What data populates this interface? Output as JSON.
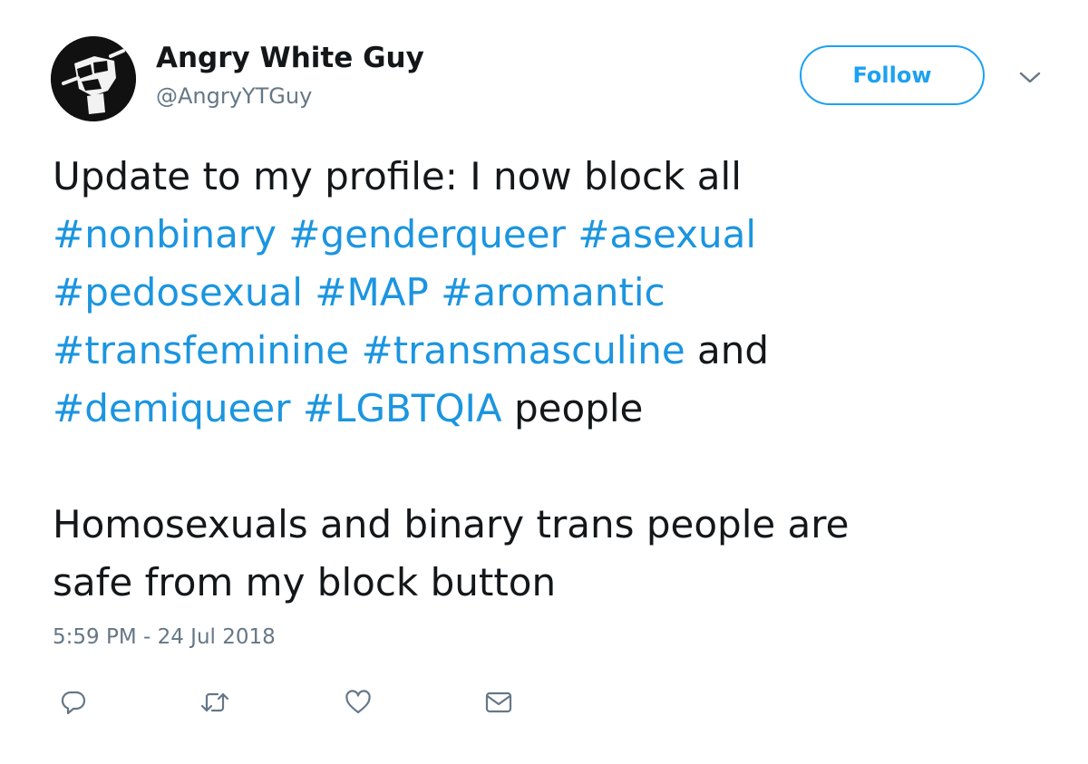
{
  "author": {
    "display_name": "Angry White Guy",
    "handle": "@AngryYTGuy",
    "avatar_icon": "raised-fist-icon"
  },
  "header": {
    "follow_label": "Follow",
    "menu_icon": "chevron-down-icon"
  },
  "tweet": {
    "lines": [
      [
        {
          "text": "Update to my profile: I now block all",
          "type": "text"
        }
      ],
      [
        {
          "text": "#nonbinary",
          "type": "hashtag"
        },
        {
          "text": " ",
          "type": "text"
        },
        {
          "text": "#genderqueer",
          "type": "hashtag"
        },
        {
          "text": " ",
          "type": "text"
        },
        {
          "text": "#asexual",
          "type": "hashtag"
        }
      ],
      [
        {
          "text": "#pedosexual",
          "type": "hashtag"
        },
        {
          "text": " ",
          "type": "text"
        },
        {
          "text": "#MAP",
          "type": "hashtag"
        },
        {
          "text": " ",
          "type": "text"
        },
        {
          "text": "#aromantic",
          "type": "hashtag"
        }
      ],
      [
        {
          "text": "#transfeminine",
          "type": "hashtag"
        },
        {
          "text": " ",
          "type": "text"
        },
        {
          "text": "#transmasculine",
          "type": "hashtag"
        },
        {
          "text": " and",
          "type": "text"
        }
      ],
      [
        {
          "text": "#demiqueer",
          "type": "hashtag"
        },
        {
          "text": " ",
          "type": "text"
        },
        {
          "text": "#LGBTQIA",
          "type": "hashtag"
        },
        {
          "text": " people",
          "type": "text"
        }
      ],
      [],
      [
        {
          "text": "Homosexuals and binary trans people are",
          "type": "text"
        }
      ],
      [
        {
          "text": "safe from my block button",
          "type": "text"
        }
      ]
    ],
    "timestamp": "5:59 PM - 24 Jul 2018"
  },
  "actions": [
    {
      "name": "reply-icon"
    },
    {
      "name": "retweet-icon"
    },
    {
      "name": "like-icon"
    },
    {
      "name": "direct-message-icon"
    }
  ],
  "colors": {
    "accent": "#1da1f2",
    "hashtag": "#1b95e0",
    "text": "#14171a",
    "muted": "#657786",
    "action_icon": "#657786"
  }
}
